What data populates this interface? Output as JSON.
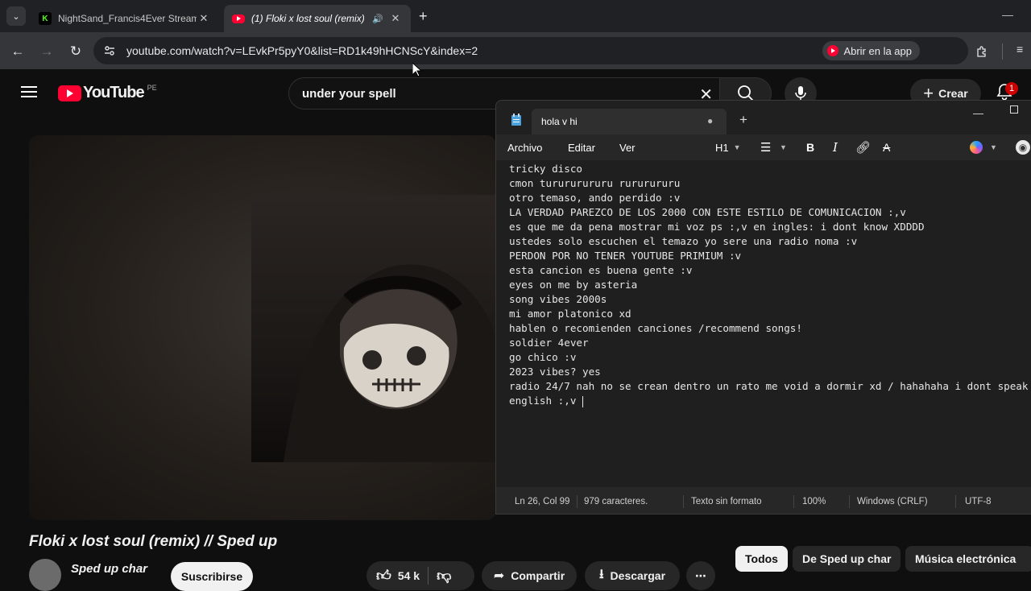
{
  "browser": {
    "tabs": [
      {
        "title": "NightSand_Francis4Ever Stream",
        "favicon": "K",
        "active": false
      },
      {
        "title": "(1) Floki x lost soul (remix)",
        "favicon": "yt",
        "active": true
      }
    ],
    "url": "youtube.com/watch?v=LEvkPr5pyY0&list=RD1k49hHCNScY&index=2",
    "open_app_label": "Abrir en la app"
  },
  "youtube": {
    "logo_text": "YouTube",
    "country": "PE",
    "search_value": "under your spell",
    "create_label": "Crear",
    "notif_count": "1",
    "video_title": "Floki x lost soul (remix) // Sped up",
    "channel_name": "Sped up char",
    "subscribe_label": "Suscribirse",
    "likes": "54 k",
    "share_label": "Compartir",
    "download_label": "Descargar",
    "chips": [
      "Todos",
      "De Sped up char",
      "Música electrónica"
    ]
  },
  "notepad": {
    "tab_title": "hola v  hi",
    "menu": [
      "Archivo",
      "Editar",
      "Ver"
    ],
    "heading_label": "H1",
    "lines": [
      "tricky disco",
      "cmon turururururu rururururu",
      "otro temaso, ando perdido :v",
      "LA VERDAD PAREZCO DE LOS 2000 CON ESTE ESTILO DE COMUNICACION :,v",
      "es que me da pena mostrar mi voz ps :,v en ingles: i dont know XDDDD",
      "ustedes solo escuchen el temazo yo sere una radio noma :v",
      "PERDON POR NO TENER YOUTUBE PRIMIUM :v",
      "esta cancion es buena gente :v",
      "eyes on me by asteria",
      "song vibes 2000s",
      "mi amor platonico xd",
      "hablen o recomienden canciones /recommend songs!",
      "soldier 4ever",
      "go chico :v",
      "2023 vibes? yes",
      "radio 24/7 nah no se crean dentro un rato me void a dormir xd / hahahaha i dont speak english :,v "
    ],
    "status": {
      "position": "Ln 26, Col 99",
      "chars": "979 caracteres.",
      "format": "Texto sin formato",
      "zoom": "100%",
      "eol": "Windows (CRLF)",
      "encoding": "UTF-8"
    }
  }
}
